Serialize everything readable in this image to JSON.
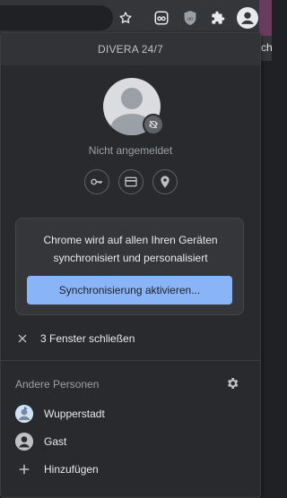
{
  "menu": {
    "title": "DIVERA 24/7",
    "status": "Nicht angemeldet",
    "quick_actions": [
      {
        "name": "passwords",
        "icon": "key-icon"
      },
      {
        "name": "payment-methods",
        "icon": "credit-card-icon"
      },
      {
        "name": "addresses",
        "icon": "location-pin-icon"
      }
    ],
    "sync": {
      "text": "Chrome wird auf allen Ihren Geräten synchronisiert und personalisiert",
      "button_label": "Synchronisierung aktivieren..."
    },
    "close_windows_label": "3 Fenster schließen",
    "other_people": {
      "heading": "Andere Personen",
      "people": [
        {
          "label": "Wupperstadt",
          "icon": "profile-picture-icon"
        },
        {
          "label": "Gast",
          "icon": "guest-icon"
        },
        {
          "label": "Hinzufügen",
          "icon": "plus-icon"
        }
      ]
    }
  },
  "toolbar": {
    "icons": [
      "star-icon",
      "reading-mode-icon",
      "ublock-icon",
      "extensions-icon",
      "profile-icon"
    ]
  },
  "background": {
    "partial_text": "ch"
  },
  "colors": {
    "menu_bg": "#292a2d",
    "accent_button": "#8ab4f8",
    "toolbar_bg": "#35363a"
  }
}
